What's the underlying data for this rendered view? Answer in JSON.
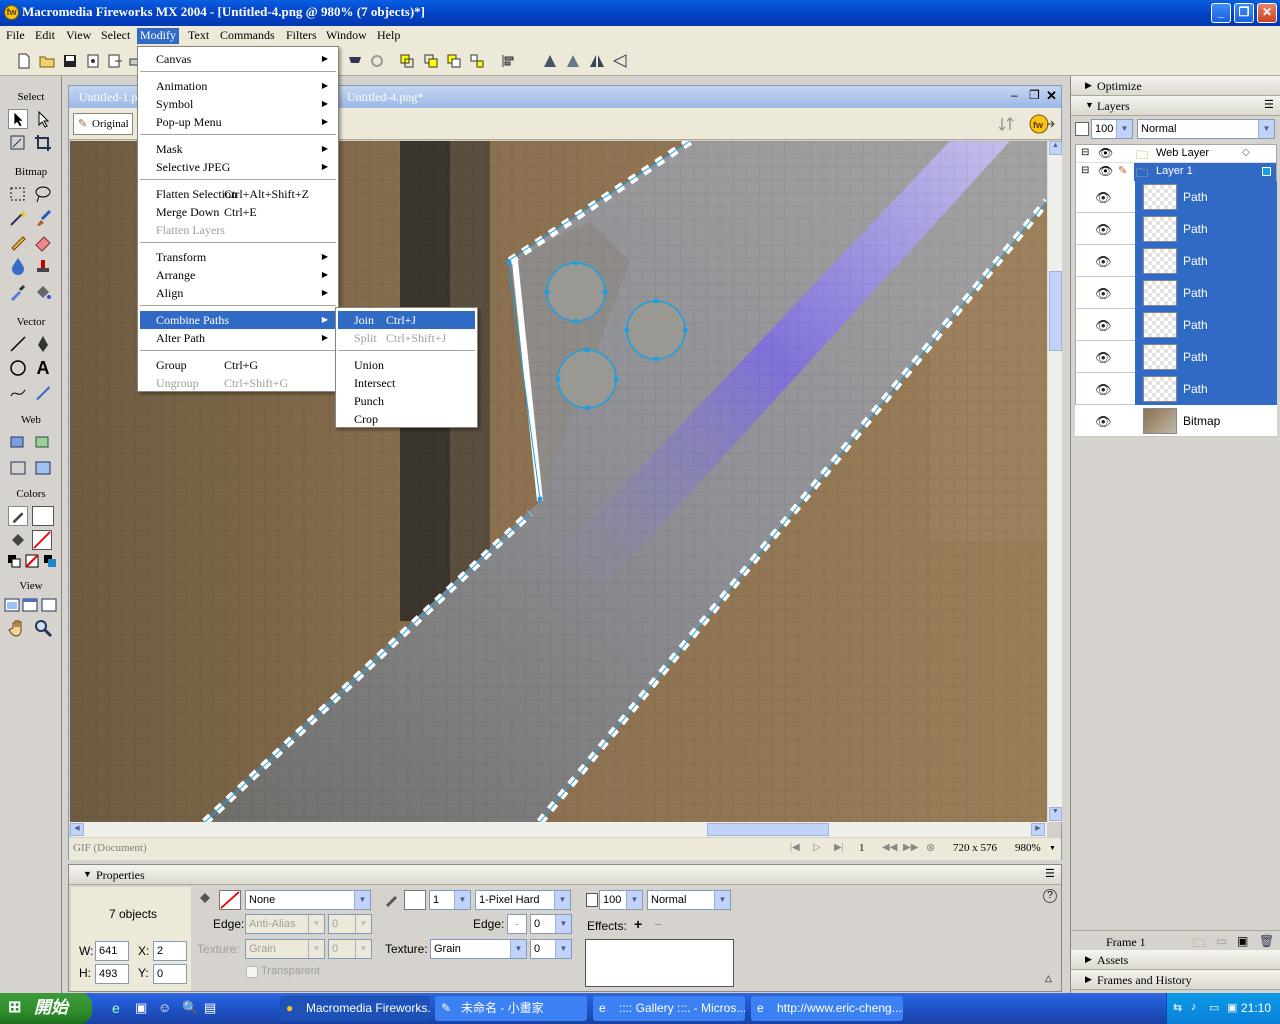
{
  "window": {
    "title": "Macromedia Fireworks MX 2004 - [Untitled-4.png @ 980% (7 objects)*]"
  },
  "menubar": [
    "File",
    "Edit",
    "View",
    "Select",
    "Modify",
    "Text",
    "Commands",
    "Filters",
    "Window",
    "Help"
  ],
  "tools": {
    "sections": [
      "Select",
      "Bitmap",
      "Vector",
      "Web",
      "Colors",
      "View"
    ]
  },
  "document": {
    "tabs": [
      "Untitled-1.p",
      "Untitled-4.png*"
    ],
    "view_button": "Original",
    "status_format": "GIF (Document)",
    "frame": "1",
    "size": "720 x 576",
    "zoom": "980%"
  },
  "modify_menu": [
    {
      "label": "Canvas",
      "arrow": true
    },
    {
      "sep": true
    },
    {
      "label": "Animation",
      "arrow": true
    },
    {
      "label": "Symbol",
      "arrow": true
    },
    {
      "label": "Pop-up Menu",
      "arrow": true
    },
    {
      "sep": true
    },
    {
      "label": "Mask",
      "arrow": true
    },
    {
      "label": "Selective JPEG",
      "arrow": true
    },
    {
      "sep": true
    },
    {
      "label": "Flatten Selection",
      "shortcut": "Ctrl+Alt+Shift+Z"
    },
    {
      "label": "Merge Down",
      "shortcut": "Ctrl+E"
    },
    {
      "label": "Flatten Layers",
      "disabled": true
    },
    {
      "sep": true
    },
    {
      "label": "Transform",
      "arrow": true
    },
    {
      "label": "Arrange",
      "arrow": true
    },
    {
      "label": "Align",
      "arrow": true
    },
    {
      "sep": true
    },
    {
      "label": "Combine Paths",
      "arrow": true,
      "highlight": true
    },
    {
      "label": "Alter Path",
      "arrow": true
    },
    {
      "sep": true
    },
    {
      "label": "Group",
      "shortcut": "Ctrl+G"
    },
    {
      "label": "Ungroup",
      "shortcut": "Ctrl+Shift+G",
      "disabled": true
    }
  ],
  "combine_menu": [
    {
      "label": "Join",
      "shortcut": "Ctrl+J",
      "highlight": true
    },
    {
      "label": "Split",
      "shortcut": "Ctrl+Shift+J",
      "disabled": true
    },
    {
      "sep": true
    },
    {
      "label": "Union"
    },
    {
      "label": "Intersect"
    },
    {
      "label": "Punch"
    },
    {
      "label": "Crop"
    }
  ],
  "panels": {
    "optimize": "Optimize",
    "layers": "Layers",
    "opacity": "100",
    "blend": "Normal",
    "web_layer": "Web Layer",
    "layer1": "Layer 1",
    "objects": [
      "Path",
      "Path",
      "Path",
      "Path",
      "Path",
      "Path",
      "Path",
      "Bitmap"
    ],
    "frame": "Frame 1",
    "assets": "Assets",
    "frames_history": "Frames and History"
  },
  "properties": {
    "title": "Properties",
    "objects": "7 objects",
    "w_label": "W:",
    "w": "641",
    "h_label": "H:",
    "h": "493",
    "x_label": "X:",
    "x": "2",
    "y_label": "Y:",
    "y": "0",
    "fill": "None",
    "edge_label": "Edge:",
    "fill_edge": "Anti-Alias",
    "fill_edge_val": "0",
    "texture_label": "Texture:",
    "fill_texture": "Grain",
    "fill_texture_val": "0",
    "transparent": "Transparent",
    "stroke_size": "1",
    "stroke_type": "1-Pixel Hard",
    "stroke_edge_val": "0",
    "stroke_texture": "Grain",
    "stroke_texture_val": "0",
    "opacity": "100",
    "blend": "Normal",
    "effects": "Effects:"
  },
  "taskbar": {
    "start": "開始",
    "tasks": [
      "Macromedia Fireworks...",
      "未命名 - 小畫家",
      ":::: Gallery :::. - Micros...",
      "http://www.eric-cheng...."
    ],
    "time": "21:10"
  },
  "colors": {
    "accent": "#316ac5",
    "xp_blue": "#0a5fe0",
    "selection": "#1a9fe0"
  }
}
